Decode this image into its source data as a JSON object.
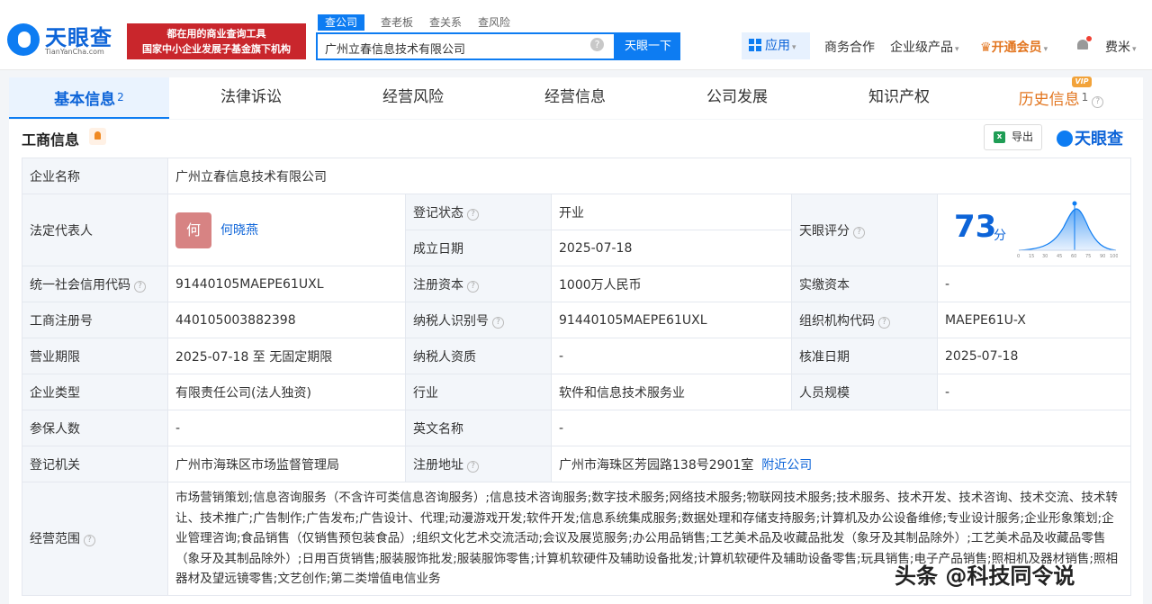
{
  "header": {
    "logo_text": "天眼查",
    "logo_sub": "TianYanCha.com",
    "banner_line1": "都在用的商业查询工具",
    "banner_line2": "国家中小企业发展子基金旗下机构",
    "search_tabs": [
      "查公司",
      "查老板",
      "查关系",
      "查风险"
    ],
    "search_value": "广州立春信息技术有限公司",
    "clear_icon": "×",
    "search_button": "天眼一下",
    "nav": {
      "app": "应用",
      "business": "商务合作",
      "enterprise": "企业级产品",
      "vip": "开通会员",
      "user": "费米"
    }
  },
  "tabs": [
    {
      "label": "基本信息",
      "count": "2"
    },
    {
      "label": "法律诉讼"
    },
    {
      "label": "经营风险"
    },
    {
      "label": "经营信息"
    },
    {
      "label": "公司发展"
    },
    {
      "label": "知识产权"
    },
    {
      "label": "历史信息",
      "count": "1"
    }
  ],
  "vip_tag": "VIP",
  "section": {
    "title": "工商信息",
    "export": "导出",
    "excel_icon": "x",
    "brand": "天眼查"
  },
  "info": {
    "company_name_label": "企业名称",
    "company_name": "广州立春信息技术有限公司",
    "legal_rep_label": "法定代表人",
    "legal_rep_avatar": "何",
    "legal_rep": "何晓燕",
    "reg_status_label": "登记状态",
    "reg_status": "开业",
    "est_date_label": "成立日期",
    "est_date": "2025-07-18",
    "score_label": "天眼评分",
    "score": "73",
    "score_unit": "分",
    "credit_code_label": "统一社会信用代码",
    "credit_code": "91440105MAEPE61UXL",
    "reg_capital_label": "注册资本",
    "reg_capital": "1000万人民币",
    "paid_capital_label": "实缴资本",
    "paid_capital": "-",
    "reg_no_label": "工商注册号",
    "reg_no": "440105003882398",
    "taxpayer_id_label": "纳税人识别号",
    "taxpayer_id": "91440105MAEPE61UXL",
    "org_code_label": "组织机构代码",
    "org_code": "MAEPE61U-X",
    "term_label": "营业期限",
    "term": "2025-07-18 至 无固定期限",
    "taxpayer_qual_label": "纳税人资质",
    "taxpayer_qual": "-",
    "approve_date_label": "核准日期",
    "approve_date": "2025-07-18",
    "type_label": "企业类型",
    "type": "有限责任公司(法人独资)",
    "industry_label": "行业",
    "industry": "软件和信息技术服务业",
    "staff_label": "人员规模",
    "staff": "-",
    "insured_label": "参保人数",
    "insured": "-",
    "en_name_label": "英文名称",
    "en_name": "-",
    "authority_label": "登记机关",
    "authority": "广州市海珠区市场监督管理局",
    "address_label": "注册地址",
    "address": "广州市海珠区芳园路138号2901室",
    "nearby": "附近公司",
    "scope_label": "经营范围",
    "scope": "市场营销策划;信息咨询服务（不含许可类信息咨询服务）;信息技术咨询服务;数字技术服务;网络技术服务;物联网技术服务;技术服务、技术开发、技术咨询、技术交流、技术转让、技术推广;广告制作;广告发布;广告设计、代理;动漫游戏开发;软件开发;信息系统集成服务;数据处理和存储支持服务;计算机及办公设备维修;专业设计服务;企业形象策划;企业管理咨询;食品销售（仅销售预包装食品）;组织文化艺术交流活动;会议及展览服务;办公用品销售;工艺美术品及收藏品批发（象牙及其制品除外）;工艺美术品及收藏品零售（象牙及其制品除外）;日用百货销售;服装服饰批发;服装服饰零售;计算机软硬件及辅助设备批发;计算机软硬件及辅助设备零售;玩具销售;电子产品销售;照相机及器材销售;照相器材及望远镜零售;文艺创作;第二类增值电信业务"
  },
  "score_axis": [
    "0",
    "15",
    "30",
    "45",
    "60",
    "75",
    "90",
    "100"
  ],
  "watermark": "头条 @科技同令说",
  "icons": {
    "question": "?",
    "caret": "▾"
  }
}
